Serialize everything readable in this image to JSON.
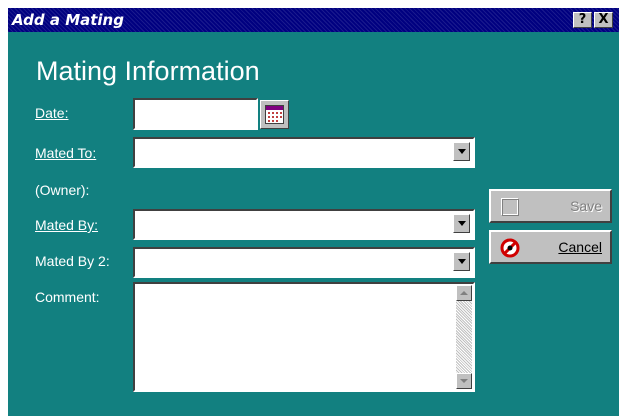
{
  "window": {
    "title": "Add a Mating",
    "help_label": "?",
    "close_label": "X"
  },
  "form": {
    "heading": "Mating Information",
    "fields": {
      "date": {
        "label": "Date:",
        "value": ""
      },
      "mated_to": {
        "label": "Mated To:",
        "value": ""
      },
      "owner": {
        "label": "(Owner):",
        "value": ""
      },
      "mated_by": {
        "label": "Mated By:",
        "value": ""
      },
      "mated_by_2": {
        "label": "Mated By 2:",
        "value": ""
      },
      "comment": {
        "label": "Comment:",
        "value": ""
      }
    }
  },
  "buttons": {
    "save_label": "Save",
    "cancel_label": "Cancel"
  },
  "colors": {
    "background": "#128080",
    "titlebar": "#000080"
  },
  "icons": {
    "calendar": "calendar-icon",
    "save": "save-icon",
    "cancel": "cancel-icon"
  }
}
